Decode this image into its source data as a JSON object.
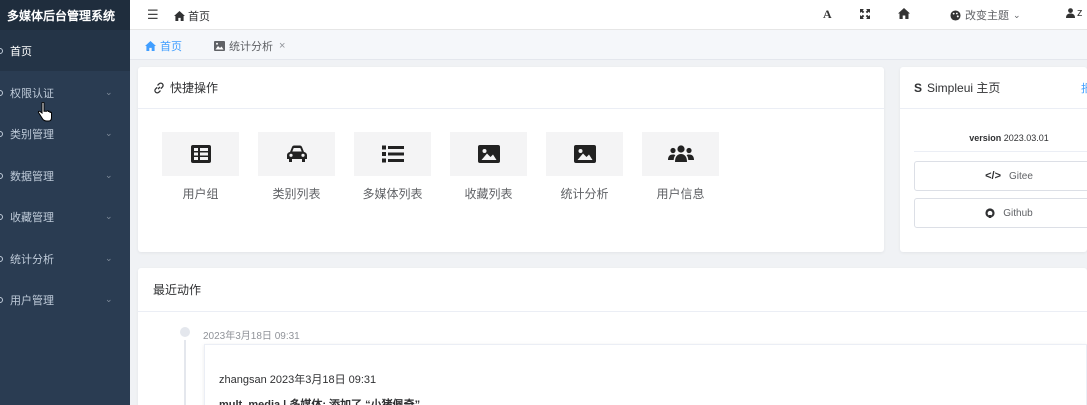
{
  "app": {
    "title": "多媒体后台管理系统"
  },
  "sidebar": {
    "items": [
      {
        "label": "首页"
      },
      {
        "label": "权限认证"
      },
      {
        "label": "类别管理"
      },
      {
        "label": "数据管理"
      },
      {
        "label": "收藏管理"
      },
      {
        "label": "统计分析"
      },
      {
        "label": "用户管理"
      }
    ]
  },
  "topbar": {
    "breadcrumb": "首页",
    "font_icon_label": "A",
    "theme_label": "改变主题",
    "user_label": "z"
  },
  "tabs": [
    {
      "label": "首页"
    },
    {
      "label": "统计分析"
    }
  ],
  "quick": {
    "title": "快捷操作",
    "items": [
      {
        "label": "用户组",
        "icon": "table-icon"
      },
      {
        "label": "类别列表",
        "icon": "car-icon"
      },
      {
        "label": "多媒体列表",
        "icon": "list-icon"
      },
      {
        "label": "收藏列表",
        "icon": "image-icon"
      },
      {
        "label": "统计分析",
        "icon": "image-icon"
      },
      {
        "label": "用户信息",
        "icon": "users-icon"
      }
    ]
  },
  "simpleui": {
    "title": "Simpleui 主页",
    "title_logo": "S",
    "edge_text": "报",
    "version_label": "version",
    "version_value": "2023.03.01",
    "gitee_label": "Gitee",
    "github_label": "Github"
  },
  "activity": {
    "title": "最近动作",
    "timestamp": "2023年3月18日 09:31",
    "entry_header": "zhangsan 2023年3月18日 09:31",
    "entry_body": "mult_media | 多媒体: 添加了 “小猪佩奇”"
  },
  "colors": {
    "sidebar_bg": "#2a3c52",
    "accent": "#409eff"
  }
}
